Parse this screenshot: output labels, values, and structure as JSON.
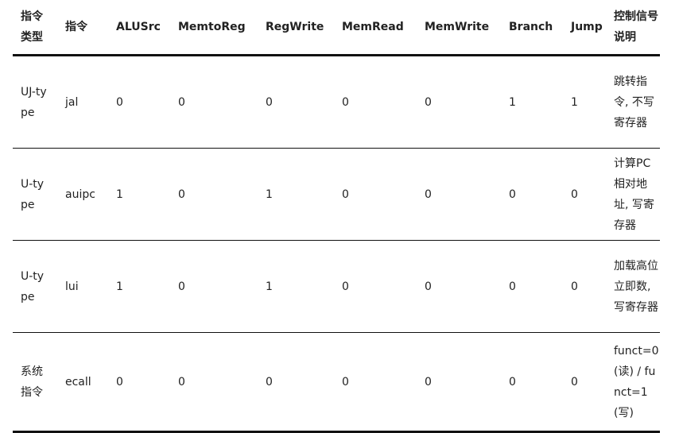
{
  "headers": {
    "type": "指令类型",
    "instr": "指令",
    "alusrc": "ALUSrc",
    "memtoreg": "MemtoReg",
    "regwrite": "RegWrite",
    "memread": "MemRead",
    "memwrite": "MemWrite",
    "branch": "Branch",
    "jump": "Jump",
    "desc": "控制信号说明"
  },
  "rows": [
    {
      "type": "UJ-type",
      "instr": "jal",
      "alusrc": "0",
      "memtoreg": "0",
      "regwrite": "0",
      "memread": "0",
      "memwrite": "0",
      "branch": "1",
      "jump": "1",
      "desc": "跳转指令, 不写寄存器"
    },
    {
      "type": "U-type",
      "instr": "auipc",
      "alusrc": "1",
      "memtoreg": "0",
      "regwrite": "1",
      "memread": "0",
      "memwrite": "0",
      "branch": "0",
      "jump": "0",
      "desc": "计算PC相对地址, 写寄存器"
    },
    {
      "type": "U-type",
      "instr": "lui",
      "alusrc": "1",
      "memtoreg": "0",
      "regwrite": "1",
      "memread": "0",
      "memwrite": "0",
      "branch": "0",
      "jump": "0",
      "desc": "加载高位立即数, 写寄存器"
    },
    {
      "type": "系统指令",
      "instr": "ecall",
      "alusrc": "0",
      "memtoreg": "0",
      "regwrite": "0",
      "memread": "0",
      "memwrite": "0",
      "branch": "0",
      "jump": "0",
      "desc": "funct=0 (读) / funct=1 (写)"
    }
  ]
}
